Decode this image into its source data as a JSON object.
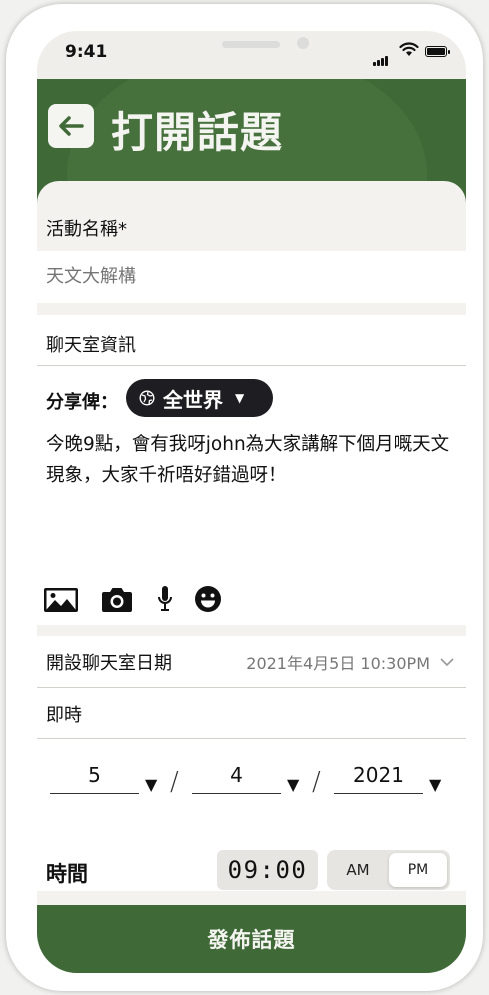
{
  "status_bar": {
    "time": "9:41"
  },
  "header": {
    "title": "打開話題"
  },
  "form": {
    "event_name_label": "活動名稱*",
    "event_name_placeholder": "天文大解構",
    "chat_info_label": "聊天室資訊",
    "share_label": "分享俾：",
    "share_option": "全世界",
    "message": "今晚9點，會有我呀john為大家講解下個月嘅天文現象，大家千祈唔好錯過呀！",
    "open_date_label": "開設聊天室日期",
    "open_date_value": "2021年4月5日 10:30PM",
    "instant_label": "即時",
    "date": {
      "day": "5",
      "month": "4",
      "year": "2021"
    },
    "time_label": "時間",
    "time_value": "09:00",
    "am_label": "AM",
    "pm_label": "PM",
    "selected_period": "PM"
  },
  "tools": [
    "image-icon",
    "camera-icon",
    "microphone-icon",
    "emoji-icon"
  ],
  "publish_button": "發佈話題",
  "colors": {
    "brand_green": "#3f6a37",
    "pill_dark": "#1e1e22"
  }
}
